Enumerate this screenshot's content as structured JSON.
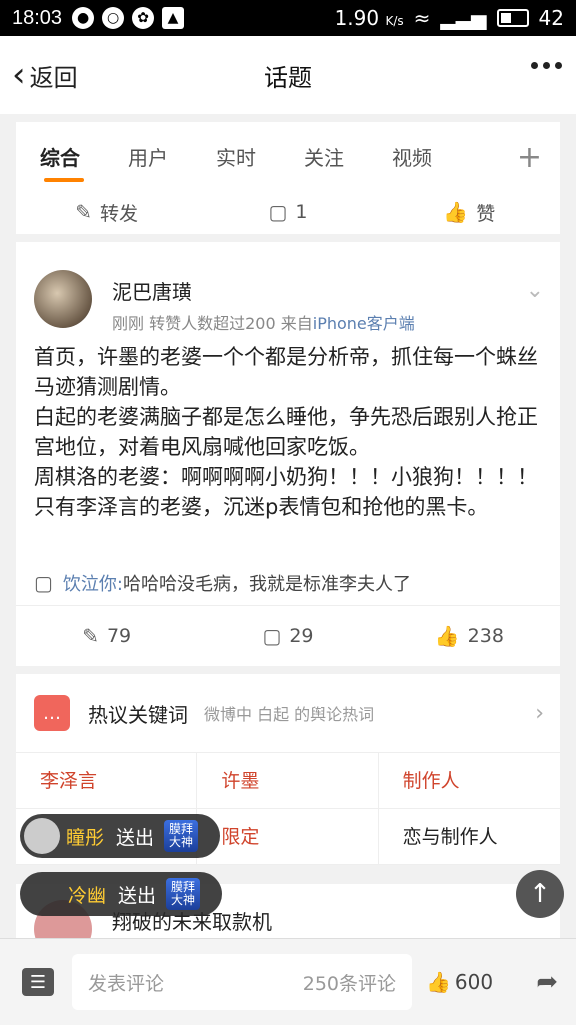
{
  "status": {
    "time": "18:03",
    "speed": "1.90",
    "speed_unit": "K/s",
    "battery": "42"
  },
  "nav": {
    "back_label": "返回",
    "title": "话题"
  },
  "tabs": [
    "综合",
    "用户",
    "实时",
    "关注",
    "视频"
  ],
  "prev_actions": {
    "repost": "转发",
    "comment": "1",
    "like": "赞"
  },
  "post": {
    "user": "泥巴唐璜",
    "meta": "刚刚 转赞人数超过200",
    "source_prefix": "来自",
    "source": "iPhone客户端",
    "content": "首页，许墨的老婆一个个都是分析帝，抓住每一个蛛丝马迹猜测剧情。\n白起的老婆满脑子都是怎么睡他，争先恐后跟别人抢正宫地位，对着电风扇喊他回家吃饭。\n周棋洛的老婆：啊啊啊啊小奶狗！！！小狼狗！！！！\n只有李泽言的老婆，沉迷p表情包和抢他的黑卡。",
    "comment_user": "饮泣你:",
    "comment_text": "哈哈哈没毛病，我就是标准李夫人了",
    "reposts": "79",
    "comments": "29",
    "likes": "238"
  },
  "hot": {
    "title": "热议关键词",
    "subtitle": "微博中 白起 的舆论热词",
    "keywords": [
      "李泽言",
      "许墨",
      "制作人",
      "",
      "限定",
      "恋与制作人"
    ]
  },
  "toasts": [
    {
      "name": "瞳彤",
      "action": "送出",
      "badge_top": "膜拜",
      "badge_bottom": "大神"
    },
    {
      "name": "冷幽",
      "action": "送出",
      "badge_top": "膜拜",
      "badge_bottom": "大神"
    }
  ],
  "next_post_user": "翔破的未来取款机",
  "bottom": {
    "comment_placeholder": "发表评论",
    "comment_count": "250条评论",
    "likes": "600"
  }
}
